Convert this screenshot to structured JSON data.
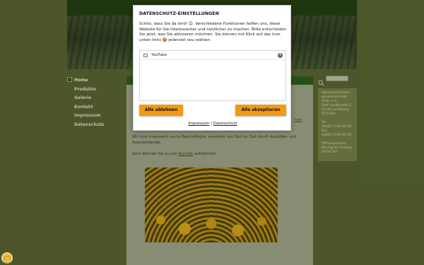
{
  "website": {
    "nav": {
      "items": [
        {
          "label": "Home"
        },
        {
          "label": "Produkte"
        },
        {
          "label": "Galerie"
        },
        {
          "label": "Kontakt"
        },
        {
          "label": "Impressum"
        },
        {
          "label": "Datenschutz"
        }
      ]
    },
    "content": {
      "paragraph_1": "Wir sind insgesamt sechs Beschäftigte; verstärkt von Zeit zu Zeit durch Aushilfen und Auszubildende.",
      "paragraph_2_prefix": "Gern können Sie zu uns ",
      "paragraph_2_link": "Kontakt",
      "paragraph_2_suffix": " aufnehmen.",
      "partial_link": "hier"
    },
    "sidebar": {
      "lines": [
        "Agrarproduktions-",
        "genossenschaft",
        "Fellin e.G.",
        "Dorf Landstraße 2",
        "01 00 Landsberg",
        "OT Fellin",
        "",
        "Tel.",
        "(0492) 0-00-00 00",
        "Fax",
        "(0492) 0-00-00 00",
        "",
        "Öffnungszeiten",
        "Montag bis Freitag",
        "06:00 Uhr"
      ]
    }
  },
  "consent_modal": {
    "title": "DATENSCHUTZ-EINSTELLUNGEN",
    "description": "Schön, dass Sie da sind! 😊. Verschiedene Funktionen helfen uns, diese Website für Sie interessanter und nützlicher zu machen. Bitte entscheiden Sie jetzt, was Sie aktivieren möchten. Sie können mit Klick auf das Icon unten links 🍪 jederzeit neu wählen.",
    "services": [
      {
        "label": "YouTube",
        "checked": false
      }
    ],
    "info_glyph": "i",
    "reject_label": "Alle ablehnen",
    "accept_label": "Alle akzeptieren",
    "link_impressum": "Impressum",
    "link_separator": " | ",
    "link_datenschutz": "Datenschutz",
    "accent_color": "#f19a14"
  }
}
